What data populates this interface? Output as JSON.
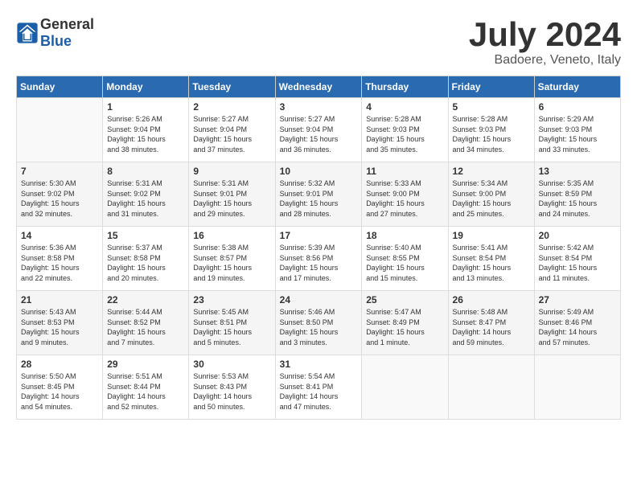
{
  "header": {
    "logo_general": "General",
    "logo_blue": "Blue",
    "month": "July 2024",
    "location": "Badoere, Veneto, Italy"
  },
  "calendar": {
    "days_of_week": [
      "Sunday",
      "Monday",
      "Tuesday",
      "Wednesday",
      "Thursday",
      "Friday",
      "Saturday"
    ],
    "weeks": [
      [
        {
          "day": "",
          "info": ""
        },
        {
          "day": "1",
          "info": "Sunrise: 5:26 AM\nSunset: 9:04 PM\nDaylight: 15 hours\nand 38 minutes."
        },
        {
          "day": "2",
          "info": "Sunrise: 5:27 AM\nSunset: 9:04 PM\nDaylight: 15 hours\nand 37 minutes."
        },
        {
          "day": "3",
          "info": "Sunrise: 5:27 AM\nSunset: 9:04 PM\nDaylight: 15 hours\nand 36 minutes."
        },
        {
          "day": "4",
          "info": "Sunrise: 5:28 AM\nSunset: 9:03 PM\nDaylight: 15 hours\nand 35 minutes."
        },
        {
          "day": "5",
          "info": "Sunrise: 5:28 AM\nSunset: 9:03 PM\nDaylight: 15 hours\nand 34 minutes."
        },
        {
          "day": "6",
          "info": "Sunrise: 5:29 AM\nSunset: 9:03 PM\nDaylight: 15 hours\nand 33 minutes."
        }
      ],
      [
        {
          "day": "7",
          "info": "Sunrise: 5:30 AM\nSunset: 9:02 PM\nDaylight: 15 hours\nand 32 minutes."
        },
        {
          "day": "8",
          "info": "Sunrise: 5:31 AM\nSunset: 9:02 PM\nDaylight: 15 hours\nand 31 minutes."
        },
        {
          "day": "9",
          "info": "Sunrise: 5:31 AM\nSunset: 9:01 PM\nDaylight: 15 hours\nand 29 minutes."
        },
        {
          "day": "10",
          "info": "Sunrise: 5:32 AM\nSunset: 9:01 PM\nDaylight: 15 hours\nand 28 minutes."
        },
        {
          "day": "11",
          "info": "Sunrise: 5:33 AM\nSunset: 9:00 PM\nDaylight: 15 hours\nand 27 minutes."
        },
        {
          "day": "12",
          "info": "Sunrise: 5:34 AM\nSunset: 9:00 PM\nDaylight: 15 hours\nand 25 minutes."
        },
        {
          "day": "13",
          "info": "Sunrise: 5:35 AM\nSunset: 8:59 PM\nDaylight: 15 hours\nand 24 minutes."
        }
      ],
      [
        {
          "day": "14",
          "info": "Sunrise: 5:36 AM\nSunset: 8:58 PM\nDaylight: 15 hours\nand 22 minutes."
        },
        {
          "day": "15",
          "info": "Sunrise: 5:37 AM\nSunset: 8:58 PM\nDaylight: 15 hours\nand 20 minutes."
        },
        {
          "day": "16",
          "info": "Sunrise: 5:38 AM\nSunset: 8:57 PM\nDaylight: 15 hours\nand 19 minutes."
        },
        {
          "day": "17",
          "info": "Sunrise: 5:39 AM\nSunset: 8:56 PM\nDaylight: 15 hours\nand 17 minutes."
        },
        {
          "day": "18",
          "info": "Sunrise: 5:40 AM\nSunset: 8:55 PM\nDaylight: 15 hours\nand 15 minutes."
        },
        {
          "day": "19",
          "info": "Sunrise: 5:41 AM\nSunset: 8:54 PM\nDaylight: 15 hours\nand 13 minutes."
        },
        {
          "day": "20",
          "info": "Sunrise: 5:42 AM\nSunset: 8:54 PM\nDaylight: 15 hours\nand 11 minutes."
        }
      ],
      [
        {
          "day": "21",
          "info": "Sunrise: 5:43 AM\nSunset: 8:53 PM\nDaylight: 15 hours\nand 9 minutes."
        },
        {
          "day": "22",
          "info": "Sunrise: 5:44 AM\nSunset: 8:52 PM\nDaylight: 15 hours\nand 7 minutes."
        },
        {
          "day": "23",
          "info": "Sunrise: 5:45 AM\nSunset: 8:51 PM\nDaylight: 15 hours\nand 5 minutes."
        },
        {
          "day": "24",
          "info": "Sunrise: 5:46 AM\nSunset: 8:50 PM\nDaylight: 15 hours\nand 3 minutes."
        },
        {
          "day": "25",
          "info": "Sunrise: 5:47 AM\nSunset: 8:49 PM\nDaylight: 15 hours\nand 1 minute."
        },
        {
          "day": "26",
          "info": "Sunrise: 5:48 AM\nSunset: 8:47 PM\nDaylight: 14 hours\nand 59 minutes."
        },
        {
          "day": "27",
          "info": "Sunrise: 5:49 AM\nSunset: 8:46 PM\nDaylight: 14 hours\nand 57 minutes."
        }
      ],
      [
        {
          "day": "28",
          "info": "Sunrise: 5:50 AM\nSunset: 8:45 PM\nDaylight: 14 hours\nand 54 minutes."
        },
        {
          "day": "29",
          "info": "Sunrise: 5:51 AM\nSunset: 8:44 PM\nDaylight: 14 hours\nand 52 minutes."
        },
        {
          "day": "30",
          "info": "Sunrise: 5:53 AM\nSunset: 8:43 PM\nDaylight: 14 hours\nand 50 minutes."
        },
        {
          "day": "31",
          "info": "Sunrise: 5:54 AM\nSunset: 8:41 PM\nDaylight: 14 hours\nand 47 minutes."
        },
        {
          "day": "",
          "info": ""
        },
        {
          "day": "",
          "info": ""
        },
        {
          "day": "",
          "info": ""
        }
      ]
    ]
  }
}
